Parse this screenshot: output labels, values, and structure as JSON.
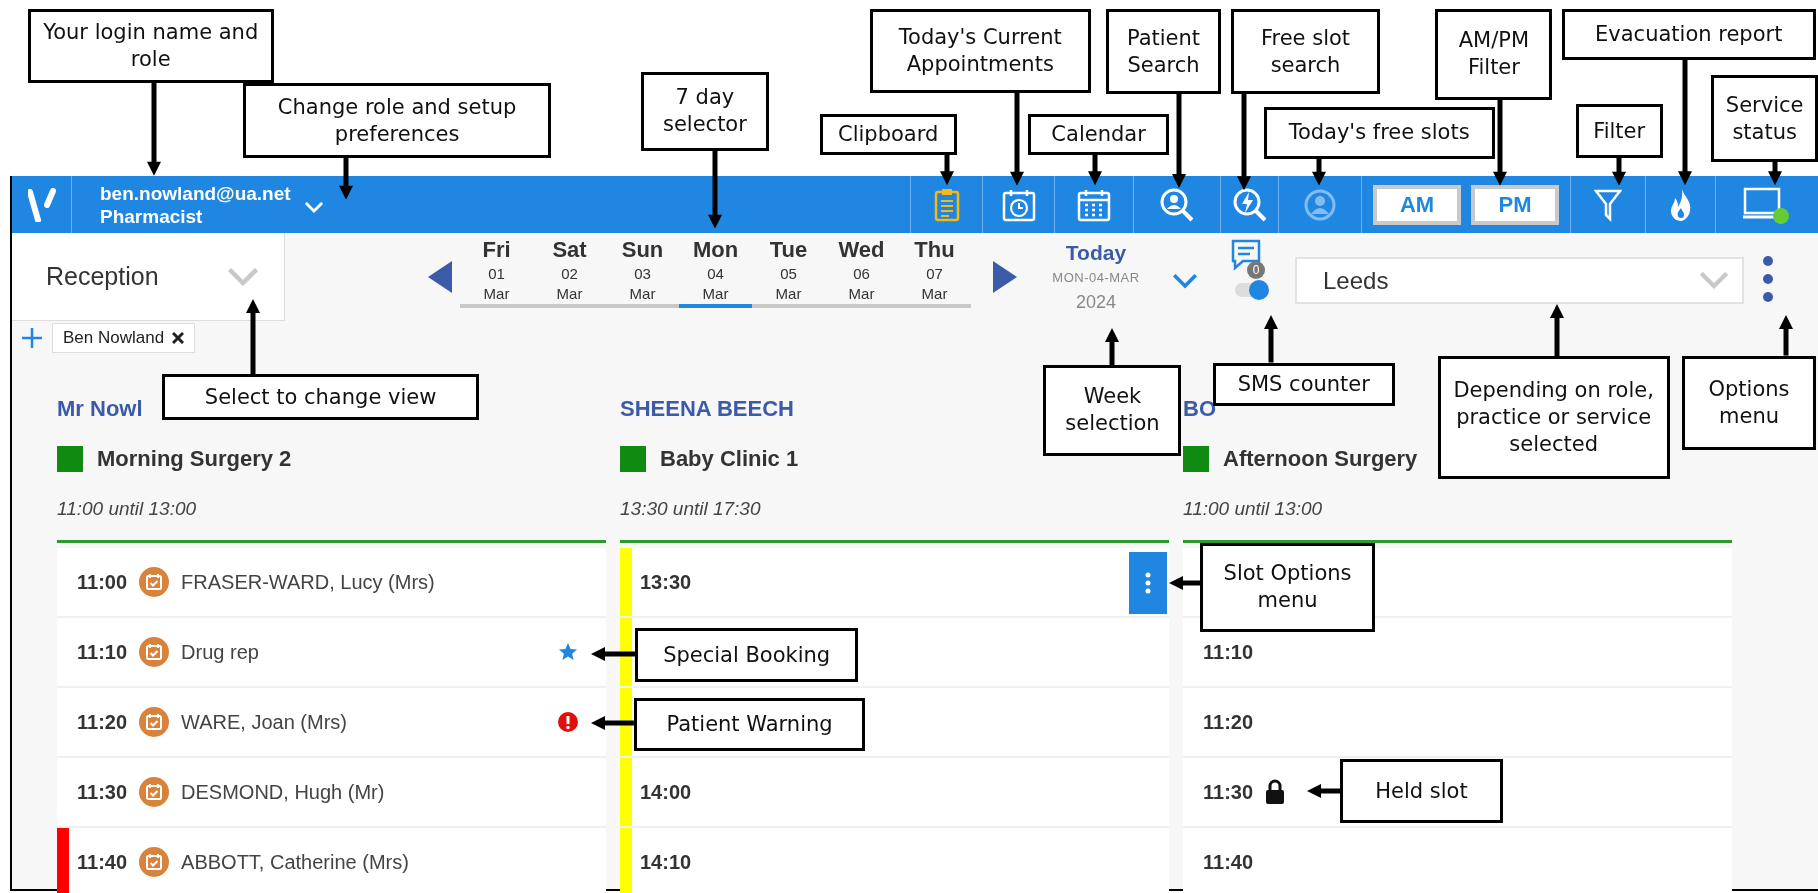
{
  "user": {
    "email": "ben.nowland@ua.net",
    "role": "Pharmacist"
  },
  "toolbar": [
    {
      "kind": "clipboard",
      "disabled": false
    },
    {
      "kind": "current_appointments",
      "disabled": false
    },
    {
      "kind": "calendar",
      "disabled": false
    },
    {
      "kind": "patient_search",
      "disabled": false
    },
    {
      "kind": "free_slot_search",
      "disabled": false
    },
    {
      "kind": "todays_free_slots",
      "disabled": true
    },
    {
      "kind": "am_pm",
      "buttons": [
        "AM",
        "PM"
      ]
    },
    {
      "kind": "filter",
      "disabled": false
    },
    {
      "kind": "evacuation",
      "disabled": false
    },
    {
      "kind": "service_status",
      "color": "#66cc33"
    }
  ],
  "view": {
    "value": "Reception"
  },
  "days": [
    {
      "day": "Fri",
      "date": "01",
      "month": "Mar",
      "selected": false
    },
    {
      "day": "Sat",
      "date": "02",
      "month": "Mar",
      "selected": false
    },
    {
      "day": "Sun",
      "date": "03",
      "month": "Mar",
      "selected": false
    },
    {
      "day": "Mon",
      "date": "04",
      "month": "Mar",
      "selected": true
    },
    {
      "day": "Tue",
      "date": "05",
      "month": "Mar",
      "selected": false
    },
    {
      "day": "Wed",
      "date": "06",
      "month": "Mar",
      "selected": false
    },
    {
      "day": "Thu",
      "date": "07",
      "month": "Mar",
      "selected": false
    }
  ],
  "week": {
    "label": "Today",
    "date": "MON-04-MAR",
    "year": "2024"
  },
  "sms": {
    "count": "0",
    "on": true
  },
  "location": {
    "value": "Leeds"
  },
  "tabs": [
    {
      "label": "Ben Nowland"
    }
  ],
  "columns": [
    {
      "clinician": "Mr Nowl",
      "session": "Morning Surgery 2",
      "hours": "11:00 until 13:00",
      "slots": [
        {
          "kind": "booked",
          "time": "11:00",
          "patient": "FRASER-WARD, Lucy (Mrs)"
        },
        {
          "kind": "special",
          "time": "11:10",
          "patient": "Drug rep"
        },
        {
          "kind": "warning",
          "time": "11:20",
          "patient": "WARE, Joan (Mrs)"
        },
        {
          "kind": "booked",
          "time": "11:30",
          "patient": "DESMOND, Hugh (Mr)"
        },
        {
          "kind": "booked",
          "time": "11:40",
          "patient": "ABBOTT, Catherine (Mrs)",
          "color": "#ff0000"
        }
      ]
    },
    {
      "clinician": "SHEENA BEECH",
      "session": "Baby Clinic 1",
      "hours": "13:30 until 17:30",
      "slots": [
        {
          "kind": "options",
          "time": "13:30",
          "color": "#ffff00"
        },
        {
          "kind": "free",
          "color": "#ffff00"
        },
        {
          "kind": "free",
          "color": "#ffff00"
        },
        {
          "kind": "free",
          "time": "14:00",
          "color": "#ffff00"
        },
        {
          "kind": "free",
          "time": "14:10",
          "color": "#ffff00"
        }
      ]
    },
    {
      "clinician": "BO",
      "session": "Afternoon Surgery",
      "hours": "11:00 until 13:00",
      "slots": [
        {
          "kind": "free"
        },
        {
          "kind": "free",
          "time": "11:10"
        },
        {
          "kind": "free",
          "time": "11:20"
        },
        {
          "kind": "held",
          "time": "11:30"
        },
        {
          "kind": "free",
          "time": "11:40"
        }
      ]
    }
  ],
  "callouts": [
    {
      "text": "Your login name and role"
    },
    {
      "text": "Change role and setup preferences"
    },
    {
      "text": "7 day selector"
    },
    {
      "text": "Clipboard"
    },
    {
      "text": "Today's Current Appointments"
    },
    {
      "text": "Calendar"
    },
    {
      "text": "Patient Search"
    },
    {
      "text": "Free slot search"
    },
    {
      "text": "Today's free slots"
    },
    {
      "text": "AM/PM Filter"
    },
    {
      "text": "Evacuation report"
    },
    {
      "text": "Filter"
    },
    {
      "text": "Service status"
    },
    {
      "text": "Select to change view"
    },
    {
      "text": "Week selection"
    },
    {
      "text": "SMS counter"
    },
    {
      "text": "Depending on role, practice or service selected"
    },
    {
      "text": "Options menu"
    },
    {
      "text": "Slot Options menu"
    },
    {
      "text": "Special Booking"
    },
    {
      "text": "Patient Warning"
    },
    {
      "text": "Held slot"
    }
  ]
}
